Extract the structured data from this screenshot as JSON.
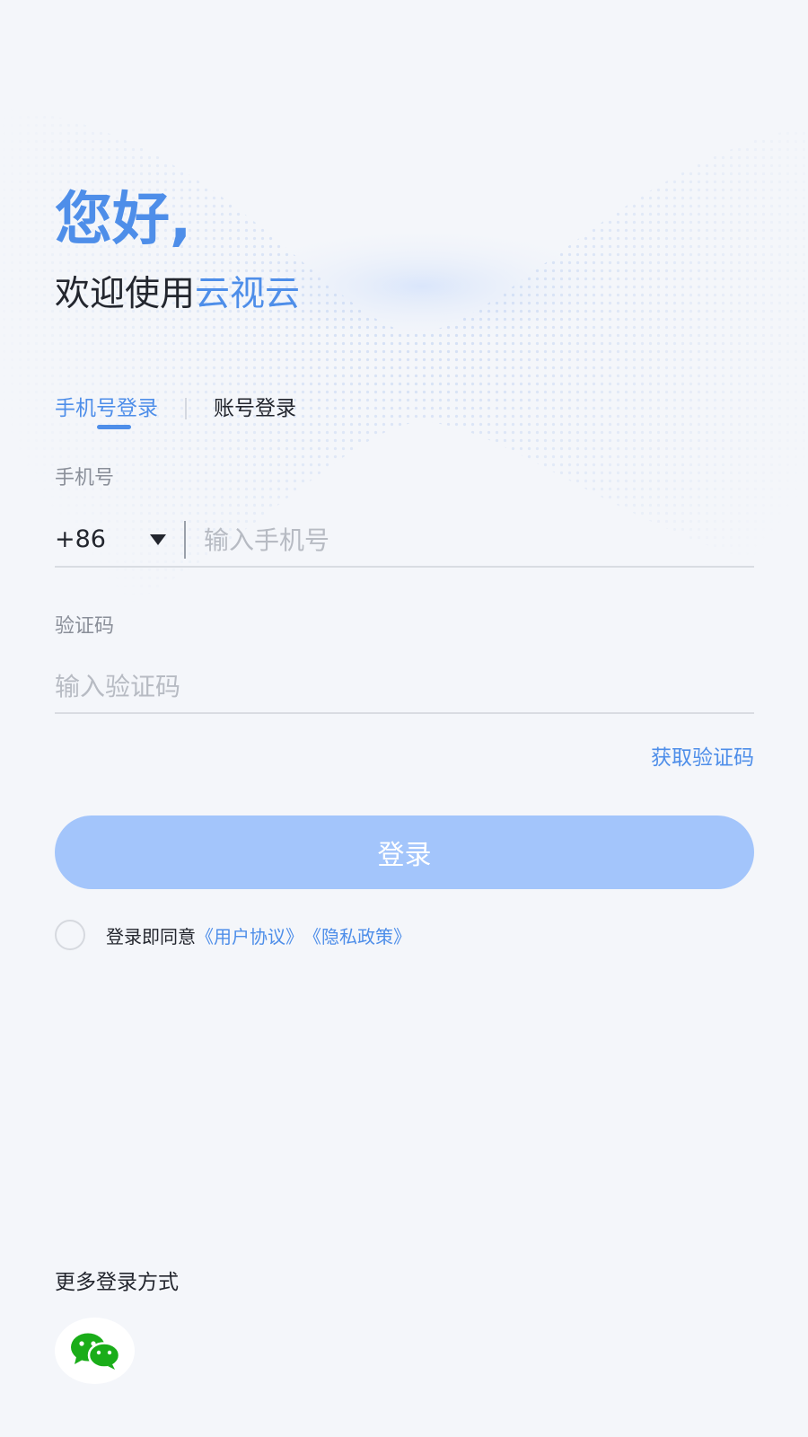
{
  "greeting": {
    "title": "您好,",
    "welcome_prefix": "欢迎使用",
    "brand": "云视云"
  },
  "tabs": [
    {
      "label": "手机号登录",
      "active": true
    },
    {
      "label": "账号登录",
      "active": false
    }
  ],
  "phone": {
    "label": "手机号",
    "country_code": "+86",
    "placeholder": "输入手机号",
    "value": ""
  },
  "code": {
    "label": "验证码",
    "placeholder": "输入验证码",
    "value": "",
    "get_code_label": "获取验证码"
  },
  "login_button": {
    "label": "登录"
  },
  "agreement": {
    "checked": false,
    "prefix": "登录即同意",
    "user_agreement": "《用户协议》",
    "privacy_policy": "《隐私政策》"
  },
  "more_login": {
    "title": "更多登录方式",
    "methods": [
      {
        "icon": "wechat-icon"
      }
    ]
  },
  "colors": {
    "accent": "#4e8ee9",
    "button_disabled": "#a3c5fb",
    "background": "#f4f6fa",
    "text_primary": "#23262e",
    "text_secondary": "#8a8f99",
    "wechat_green": "#1aad19"
  }
}
